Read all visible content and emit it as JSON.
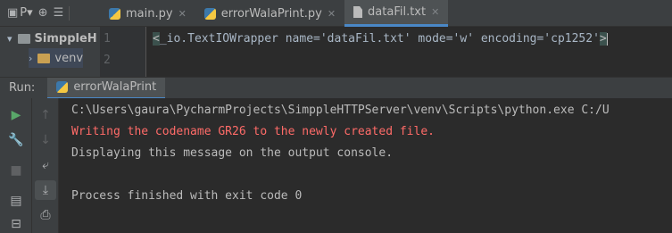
{
  "project_panel": {
    "label": "P▾",
    "tree": [
      {
        "label": "SimppleH",
        "expanded": true
      },
      {
        "label": "venv",
        "expanded": false
      }
    ]
  },
  "editor": {
    "tabs": [
      {
        "label": "main.py",
        "icon": "python-file-icon",
        "active": false
      },
      {
        "label": "errorWalaPrint.py",
        "icon": "python-file-icon",
        "active": false
      },
      {
        "label": "dataFil.txt",
        "icon": "text-file-icon",
        "active": true
      }
    ],
    "line_numbers": [
      "1",
      "2"
    ],
    "lines": [
      "_io.TextIOWrapper name='dataFil.txt' mode='w' encoding='cp1252'"
    ]
  },
  "run_panel": {
    "label": "Run:",
    "tab_label": "errorWalaPrint",
    "console": {
      "lines": [
        {
          "text": "C:\\Users\\gaura\\PycharmProjects\\SimppleHTTPServer\\venv\\Scripts\\python.exe C:/U",
          "kind": "normal"
        },
        {
          "text": "Writing the codename GR26 to the newly created file.",
          "kind": "error"
        },
        {
          "text": "Displaying this message on the output console.",
          "kind": "normal"
        },
        {
          "text": "",
          "kind": "normal"
        },
        {
          "text": "Process finished with exit code 0",
          "kind": "normal"
        }
      ]
    }
  },
  "colors": {
    "background": "#2b2b2b",
    "panel": "#3c3f41",
    "stderr_text": "#ff6b68",
    "run_green": "#59a869",
    "accent": "#4a88c7"
  }
}
